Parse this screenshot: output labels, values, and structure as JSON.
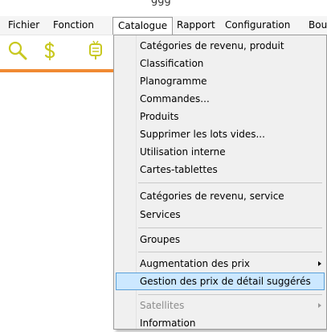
{
  "window": {
    "caption_fragment": "ggg"
  },
  "menubar": {
    "items": [
      {
        "label": "Fichier"
      },
      {
        "label": "Fonction"
      },
      {
        "label": "Catalogue"
      },
      {
        "label": "Rapport"
      },
      {
        "label": "Configuration"
      },
      {
        "label": "Bout"
      }
    ]
  },
  "toolbar": {
    "icons": [
      "magnifier-icon",
      "dollar-icon",
      "lamp-icon"
    ],
    "accent_color": "#c8c820",
    "status_bar_color": "#f08a33"
  },
  "catalogue_menu": {
    "items": [
      {
        "label": "Catégories de revenu, produit"
      },
      {
        "label": "Classification"
      },
      {
        "label": "Planogramme"
      },
      {
        "label": "Commandes..."
      },
      {
        "label": "Produits"
      },
      {
        "label": "Supprimer les lots vides..."
      },
      {
        "label": "Utilisation interne"
      },
      {
        "label": "Cartes-tablettes"
      },
      {
        "label": "Catégories de revenu, service"
      },
      {
        "label": "Services"
      },
      {
        "label": "Groupes"
      },
      {
        "label": "Augmentation des prix"
      },
      {
        "label": "Gestion des prix de détail suggérés"
      },
      {
        "label": "Satellites"
      },
      {
        "label": "Information"
      }
    ],
    "highlight_color": "#cce8ff"
  }
}
